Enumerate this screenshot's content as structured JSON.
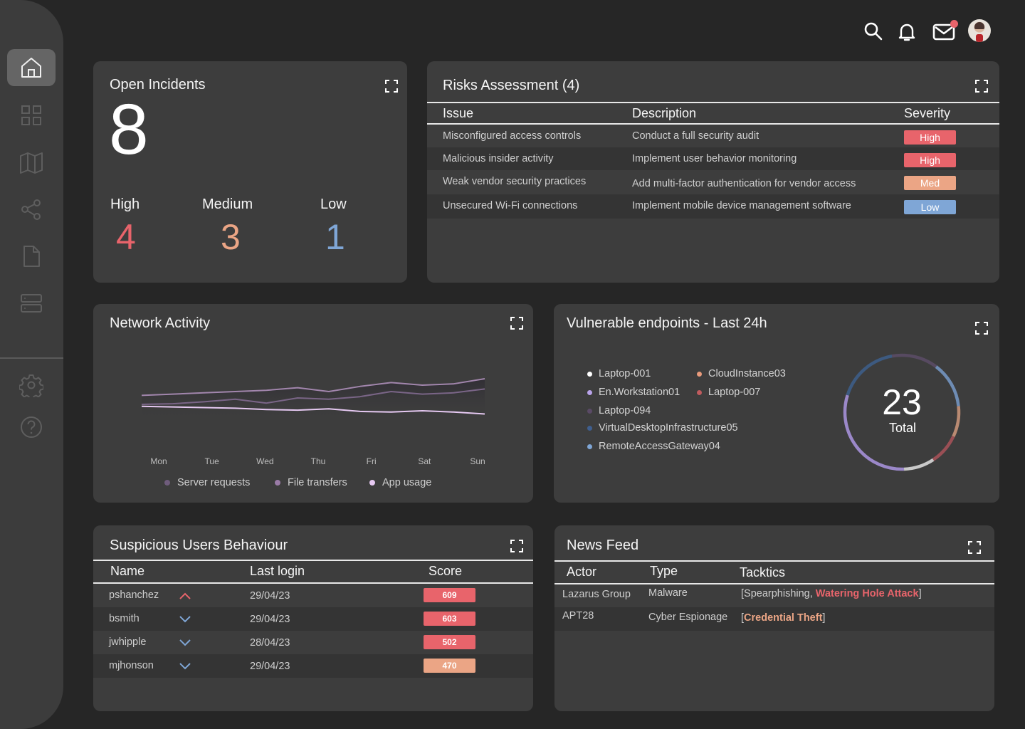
{
  "sidebar": {
    "items": [
      {
        "name": "home",
        "icon": "home-icon",
        "active": true
      },
      {
        "name": "dashboard",
        "icon": "grid-icon",
        "active": false
      },
      {
        "name": "map",
        "icon": "map-icon",
        "active": false
      },
      {
        "name": "share",
        "icon": "share-icon",
        "active": false
      },
      {
        "name": "documents",
        "icon": "document-icon",
        "active": false
      },
      {
        "name": "servers",
        "icon": "server-icon",
        "active": false
      }
    ],
    "bottom_items": [
      {
        "name": "settings",
        "icon": "gear-icon"
      },
      {
        "name": "help",
        "icon": "help-icon"
      }
    ]
  },
  "topbar": {
    "icons": [
      "search-icon",
      "bell-icon",
      "mail-icon",
      "avatar"
    ],
    "mail_has_notification": true
  },
  "colors": {
    "high": "#e8646b",
    "medium": "#eba585",
    "low": "#7fa6d6",
    "card": "#3d3d3d",
    "background": "#262626"
  },
  "open_incidents": {
    "title": "Open Incidents",
    "total": "8",
    "levels": [
      {
        "label": "High",
        "value": "4"
      },
      {
        "label": "Medium",
        "value": "3"
      },
      {
        "label": "Low",
        "value": "1"
      }
    ]
  },
  "risks": {
    "title": "Risks Assessment (4)",
    "headers": {
      "issue": "Issue",
      "description": "Description",
      "severity": "Severity"
    },
    "rows": [
      {
        "issue": "Misconfigured access controls",
        "description": "Conduct a full security audit",
        "severity": "High",
        "level": "high"
      },
      {
        "issue": "Malicious insider activity",
        "description": "Implement user behavior monitoring",
        "severity": "High",
        "level": "high"
      },
      {
        "issue": "Weak vendor security practices",
        "description": "Add multi-factor authentication for vendor access",
        "severity": "Med",
        "level": "medium"
      },
      {
        "issue": "Unsecured Wi-Fi connections",
        "description": "Implement mobile device management software",
        "severity": "Low",
        "level": "low"
      }
    ]
  },
  "network": {
    "title": "Network Activity"
  },
  "chart_data": {
    "type": "line",
    "title": "Network Activity",
    "xlabel": "",
    "ylabel": "",
    "categories": [
      "Mon",
      "Tue",
      "Wed",
      "Thu",
      "Fri",
      "Sat",
      "Sun"
    ],
    "ylim": [
      0,
      100
    ],
    "grid": false,
    "legend_position": "bottom",
    "series": [
      {
        "name": "Server requests",
        "color": "#7a6587",
        "values": [
          60,
          61,
          64,
          68,
          62,
          70,
          68,
          72,
          80,
          76,
          78,
          84
        ]
      },
      {
        "name": "File transfers",
        "color": "#a286ad",
        "values": [
          74,
          76,
          78,
          80,
          82,
          86,
          80,
          88,
          94,
          90,
          92,
          100
        ]
      },
      {
        "name": "App usage",
        "color": "#e6c9f2",
        "values": [
          57,
          56,
          55,
          54,
          52,
          51,
          53,
          49,
          48,
          50,
          48,
          45
        ]
      }
    ]
  },
  "endpoints": {
    "title": "Vulnerable endpoints - Last 24h",
    "total": "23",
    "total_label": "Total",
    "items": [
      {
        "name": "Laptop-001",
        "color": "#ffffff"
      },
      {
        "name": "CloudInstance03",
        "color": "#e99b7c"
      },
      {
        "name": "En.Workstation01",
        "color": "#b9a3ea"
      },
      {
        "name": "Laptop-007",
        "color": "#c05b5e"
      },
      {
        "name": "Laptop-094",
        "color": "#5a4a66"
      },
      {
        "name": "VirtualDesktopInfrastructure05",
        "color": "#3f5f8f"
      },
      {
        "name": "RemoteAccessGateway04",
        "color": "#7fa6d6"
      }
    ],
    "donut_segments": [
      {
        "name": "Laptop-094",
        "color": "#574a61",
        "value": 3
      },
      {
        "name": "RemoteAccessGateway04",
        "color": "#6e8cb4",
        "value": 3
      },
      {
        "name": "CloudInstance03",
        "color": "#b98a72",
        "value": 2
      },
      {
        "name": "Laptop-007",
        "color": "#9a4f55",
        "value": 2
      },
      {
        "name": "Laptop-001",
        "color": "#c9c9c9",
        "value": 2
      },
      {
        "name": "En.Workstation01",
        "color": "#9b88c9",
        "value": 7
      },
      {
        "name": "VirtualDesktopInfrastructure05",
        "color": "#3d5a80",
        "value": 4
      }
    ]
  },
  "suspicious": {
    "title": "Suspicious Users Behaviour",
    "headers": {
      "name": "Name",
      "login": "Last login",
      "score": "Score"
    },
    "rows": [
      {
        "name": "pshanchez",
        "trend": "up",
        "login": "29/04/23",
        "score": "609",
        "level": "high"
      },
      {
        "name": "bsmith",
        "trend": "down",
        "login": "29/04/23",
        "score": "603",
        "level": "high"
      },
      {
        "name": "jwhipple",
        "trend": "down",
        "login": "28/04/23",
        "score": "502",
        "level": "high"
      },
      {
        "name": "mjhonson",
        "trend": "down",
        "login": "29/04/23",
        "score": "470",
        "level": "medium"
      }
    ]
  },
  "news": {
    "title": "News Feed",
    "headers": {
      "actor": "Actor",
      "type": "Type",
      "tactics": "Tacktics"
    },
    "rows": [
      {
        "actor": "Lazarus Group",
        "type": "Malware",
        "tactics": [
          {
            "text": "Spearphishing, ",
            "level": "normal"
          },
          {
            "text": "Watering Hole Attack",
            "level": "high"
          }
        ]
      },
      {
        "actor": "APT28",
        "type": "Cyber Espionage",
        "tactics": [
          {
            "text": "Credential Theft",
            "level": "medium"
          }
        ]
      }
    ]
  }
}
